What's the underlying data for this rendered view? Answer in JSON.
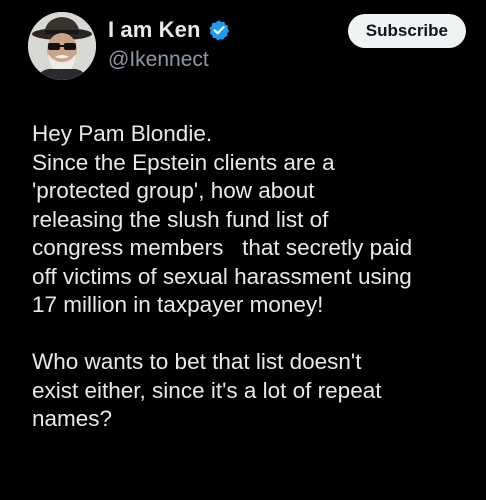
{
  "author": {
    "display_name": "I am Ken",
    "handle": "@Ikennect",
    "verified": true,
    "avatar_icon": "avatar-cowboy-hat-sunglasses"
  },
  "actions": {
    "subscribe_label": "Subscribe"
  },
  "post": {
    "paragraph1_lines": [
      "Hey Pam Blondie.",
      "Since the Epstein clients are a",
      "'protected group', how about",
      "releasing the slush fund list of",
      "congress members   that secretly paid",
      "off victims of sexual harassment using",
      "17 million in taxpayer money!"
    ],
    "paragraph2_lines": [
      "Who wants to bet that list doesn't",
      "exist either, since it's a lot of repeat",
      "names?"
    ]
  },
  "colors": {
    "background": "#000000",
    "text": "#e7e9ea",
    "secondary_text": "#8b98a5",
    "verified_badge": "#1d9bf0",
    "subscribe_bg": "#eff3f4"
  }
}
